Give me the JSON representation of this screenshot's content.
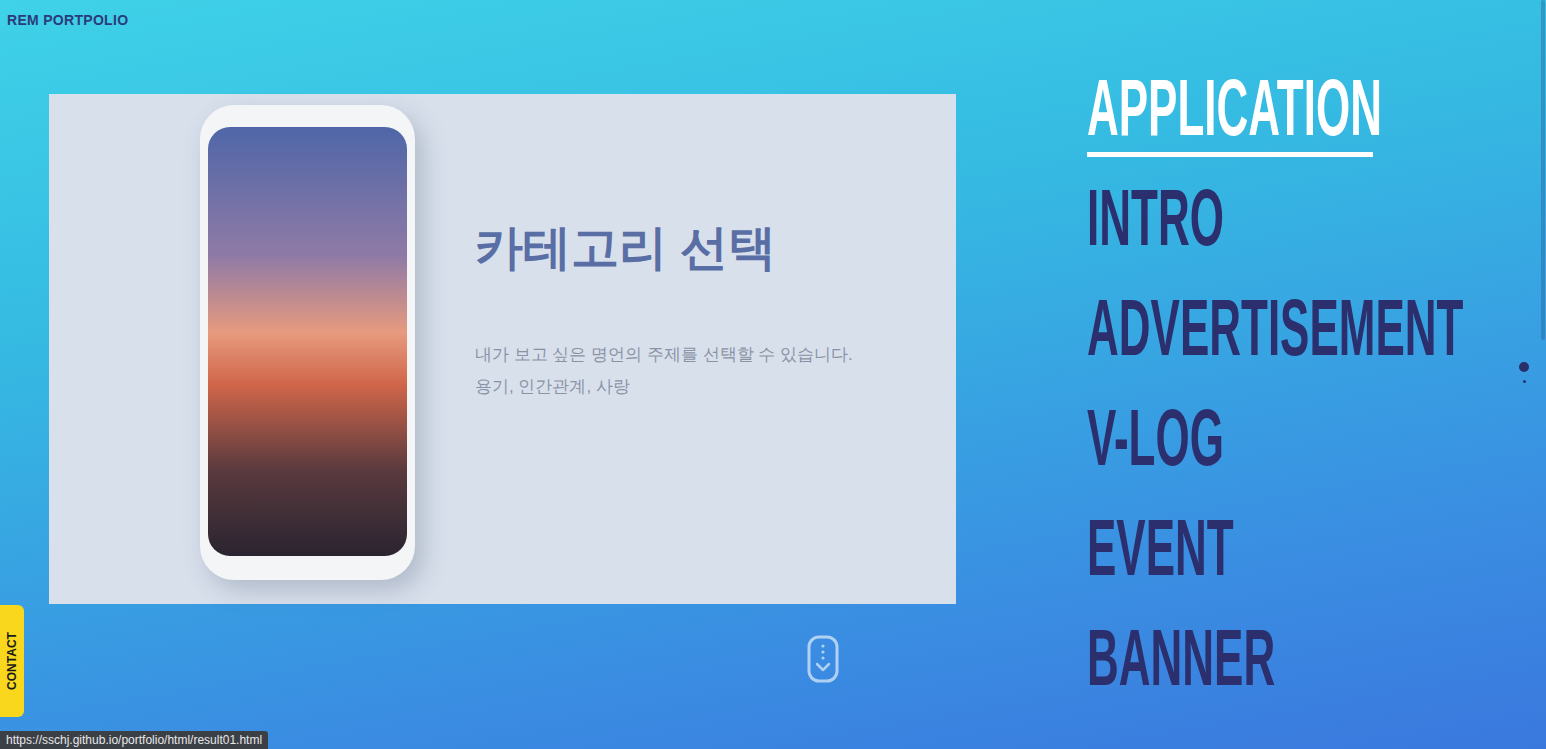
{
  "brand": "REM PORTPOLIO",
  "slide": {
    "title": "카테고리 선택",
    "description": [
      "내가 보고 싶은 명언의 주제를 선택할 수 있습니다.",
      "용기, 인간관계, 사랑"
    ]
  },
  "nav": [
    {
      "label": "APPLICATION",
      "selected": true
    },
    {
      "label": "INTRO",
      "selected": false
    },
    {
      "label": "ADVERTISEMENT",
      "selected": false
    },
    {
      "label": "V-LOG",
      "selected": false
    },
    {
      "label": "EVENT",
      "selected": false
    },
    {
      "label": "BANNER",
      "selected": false
    }
  ],
  "pager": [
    {
      "selected": true
    },
    {
      "selected": false
    }
  ],
  "contact": "CONTACT",
  "status_url": "https://sschj.github.io/portfolio/html/result01.html"
}
